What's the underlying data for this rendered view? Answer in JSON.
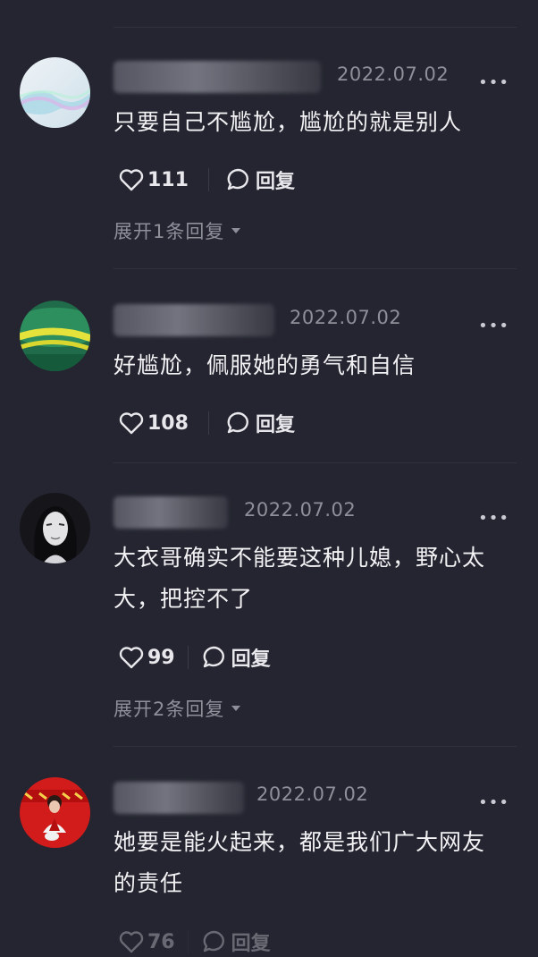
{
  "comments": [
    {
      "date": "2022.07.02",
      "text": "只要自己不尴尬，尴尬的就是别人",
      "likes": "111",
      "reply_label": "回复",
      "expand_label": "展开1条回复"
    },
    {
      "date": "2022.07.02",
      "text": "好尴尬，佩服她的勇气和自信",
      "likes": "108",
      "reply_label": "回复"
    },
    {
      "date": "2022.07.02",
      "text": "大衣哥确实不能要这种儿媳，野心太大，把控不了",
      "likes": "99",
      "reply_label": "回复",
      "expand_label": "展开2条回复"
    },
    {
      "date": "2022.07.02",
      "text": "她要是能火起来，都是我们广大网友的责任",
      "likes": "76",
      "reply_label": "回复"
    }
  ],
  "icons": {
    "more": "more-dots-icon",
    "like": "heart-icon",
    "reply": "comment-bubble-icon",
    "expand": "caret-down-icon"
  },
  "colors": {
    "background": "#242530",
    "text": "#f2f2f4",
    "muted": "#8e8f99"
  }
}
